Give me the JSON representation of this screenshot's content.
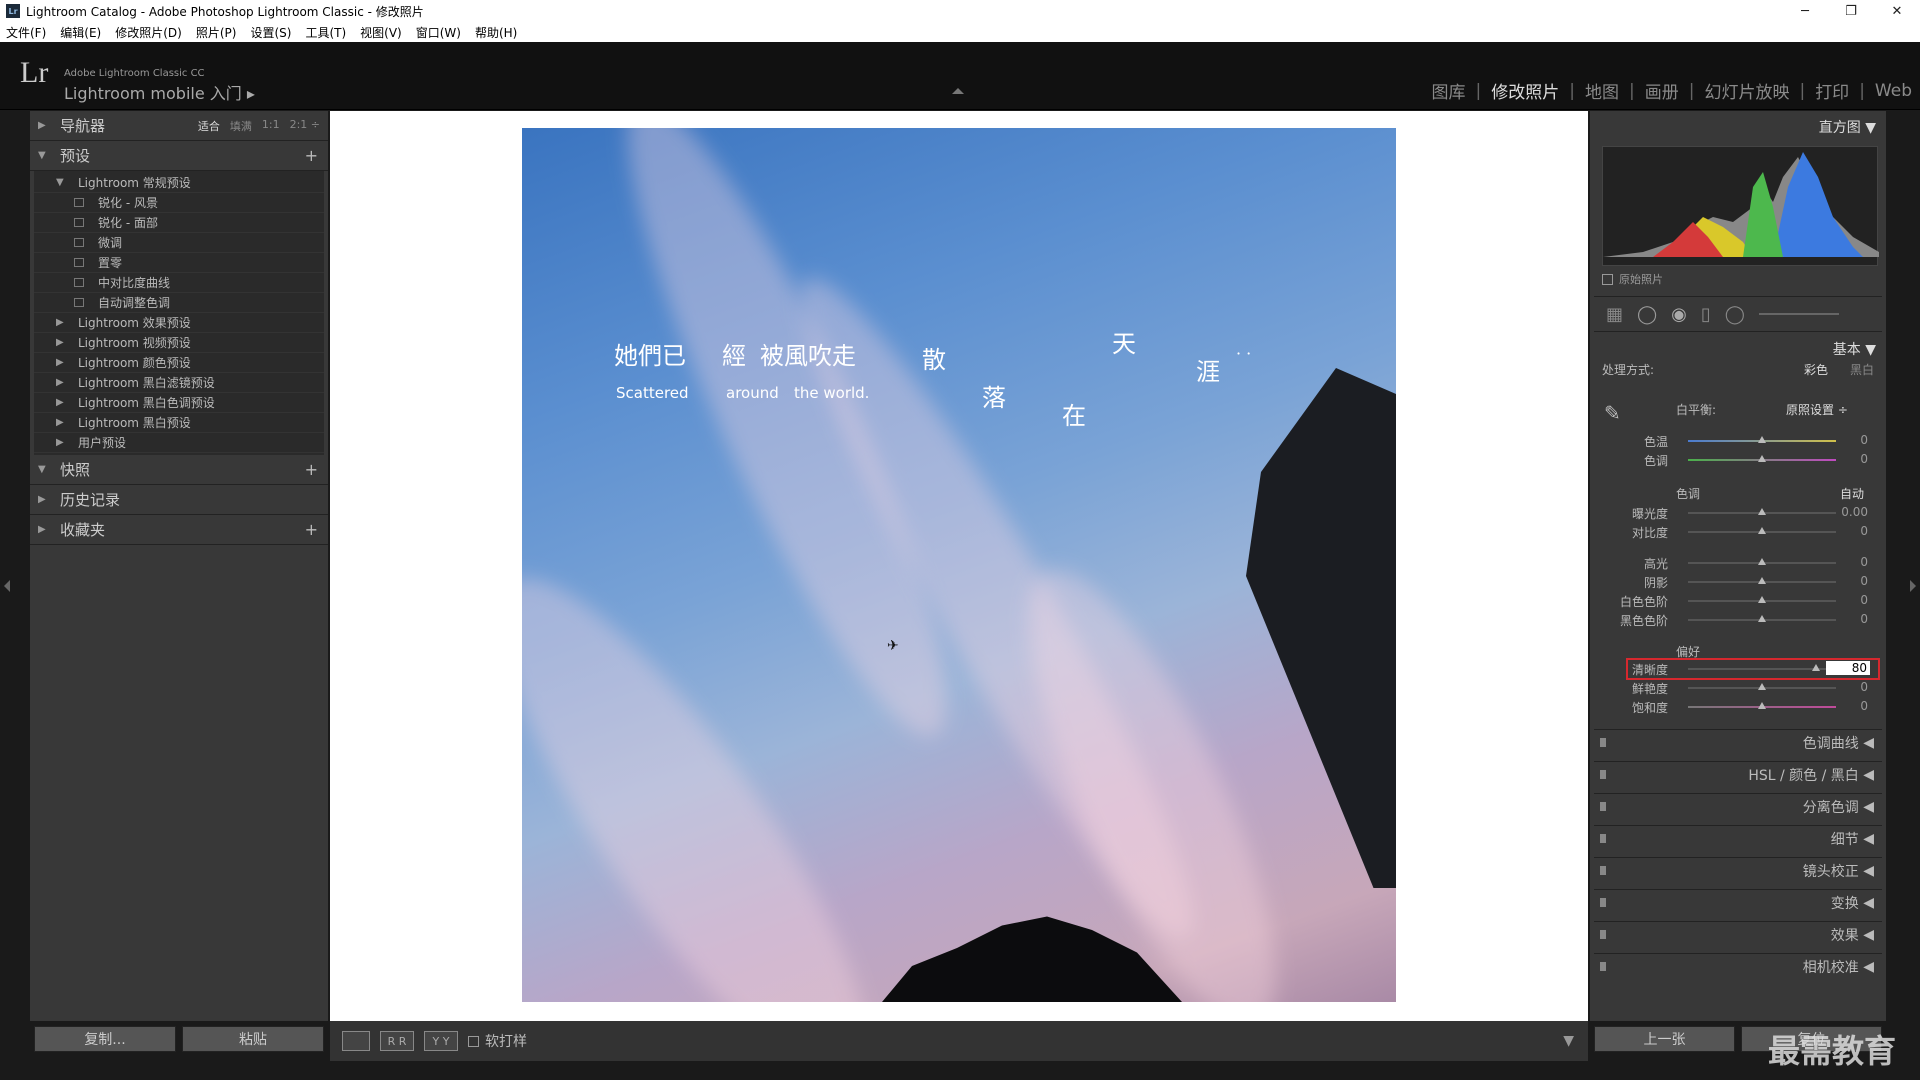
{
  "window": {
    "badge": "Lr",
    "title": "Lightroom Catalog - Adobe Photoshop Lightroom Classic - 修改照片",
    "minimize": "─",
    "maximize": "❐",
    "close": "✕"
  },
  "menu": [
    "文件(F)",
    "编辑(E)",
    "修改照片(D)",
    "照片(P)",
    "设置(S)",
    "工具(T)",
    "视图(V)",
    "窗口(W)",
    "帮助(H)"
  ],
  "identity": {
    "logo": "Lr",
    "small": "Adobe Lightroom Classic CC",
    "big": "Lightroom mobile 入门  ▸"
  },
  "modules": [
    {
      "label": "图库",
      "active": false
    },
    {
      "label": "修改照片",
      "active": true
    },
    {
      "label": "地图",
      "active": false
    },
    {
      "label": "画册",
      "active": false
    },
    {
      "label": "幻灯片放映",
      "active": false
    },
    {
      "label": "打印",
      "active": false
    },
    {
      "label": "Web",
      "active": false
    }
  ],
  "left": {
    "navigator": {
      "label": "导航器",
      "zoom": [
        "适合",
        "填满",
        "1:1",
        "2:1 ÷"
      ]
    },
    "presets": {
      "label": "预设",
      "rows": [
        {
          "type": "folder",
          "open": true,
          "label": "Lightroom 常规预设"
        },
        {
          "type": "item",
          "label": "锐化 - 风景"
        },
        {
          "type": "item",
          "label": "锐化 - 面部"
        },
        {
          "type": "item",
          "label": "微调"
        },
        {
          "type": "item",
          "label": "置零"
        },
        {
          "type": "item",
          "label": "中对比度曲线"
        },
        {
          "type": "item",
          "label": "自动调整色调"
        },
        {
          "type": "folder",
          "open": false,
          "label": "Lightroom 效果预设"
        },
        {
          "type": "folder",
          "open": false,
          "label": "Lightroom 视频预设"
        },
        {
          "type": "folder",
          "open": false,
          "label": "Lightroom 颜色预设"
        },
        {
          "type": "folder",
          "open": false,
          "label": "Lightroom 黑白滤镜预设"
        },
        {
          "type": "folder",
          "open": false,
          "label": "Lightroom 黑白色调预设"
        },
        {
          "type": "folder",
          "open": false,
          "label": "Lightroom 黑白预设"
        },
        {
          "type": "folder",
          "open": false,
          "label": "用户预设"
        }
      ]
    },
    "snapshots": "快照",
    "history": "历史记录",
    "collections": "收藏夹",
    "copy_btn": "复制...",
    "paste_btn": "粘贴"
  },
  "photo_text": {
    "line1a": "她們已",
    "line1b": "經",
    "line1c": "被風吹走",
    "c1": "散",
    "c2": "落",
    "c3": "在",
    "c4": "天",
    "c5": "涯",
    "dots": "· ·",
    "en1": "Scattered",
    "en2": "around",
    "en3": "the world."
  },
  "toolbar": {
    "soft_proof": "软打样",
    "rr": "R R",
    "yy": "Y Y"
  },
  "right": {
    "histogram": "直方图",
    "original": "原始照片",
    "basic": "基本",
    "treatment": "处理方式:",
    "color": "彩色",
    "bw": "黑白",
    "wb": "白平衡:",
    "wb_value": "原照设置 ÷",
    "tone": "色调",
    "auto": "自动",
    "presence": "偏好",
    "sliders": {
      "temp": {
        "label": "色温",
        "value": "0"
      },
      "tint": {
        "label": "色调",
        "value": "0"
      },
      "exposure": {
        "label": "曝光度",
        "value": "0.00"
      },
      "contrast": {
        "label": "对比度",
        "value": "0"
      },
      "highlights": {
        "label": "高光",
        "value": "0"
      },
      "shadows": {
        "label": "阴影",
        "value": "0"
      },
      "whites": {
        "label": "白色色阶",
        "value": "0"
      },
      "blacks": {
        "label": "黑色色阶",
        "value": "0"
      },
      "clarity": {
        "label": "清晰度",
        "value": "80"
      },
      "vibrance": {
        "label": "鲜艳度",
        "value": "0"
      },
      "saturation": {
        "label": "饱和度",
        "value": "0"
      }
    },
    "sections": [
      "色调曲线",
      "HSL / 颜色 / 黑白",
      "分离色调",
      "细节",
      "镜头校正",
      "变换",
      "效果",
      "相机校准"
    ],
    "prev_btn": "上一张",
    "reset_btn": "复位"
  },
  "watermark": "最需教育"
}
